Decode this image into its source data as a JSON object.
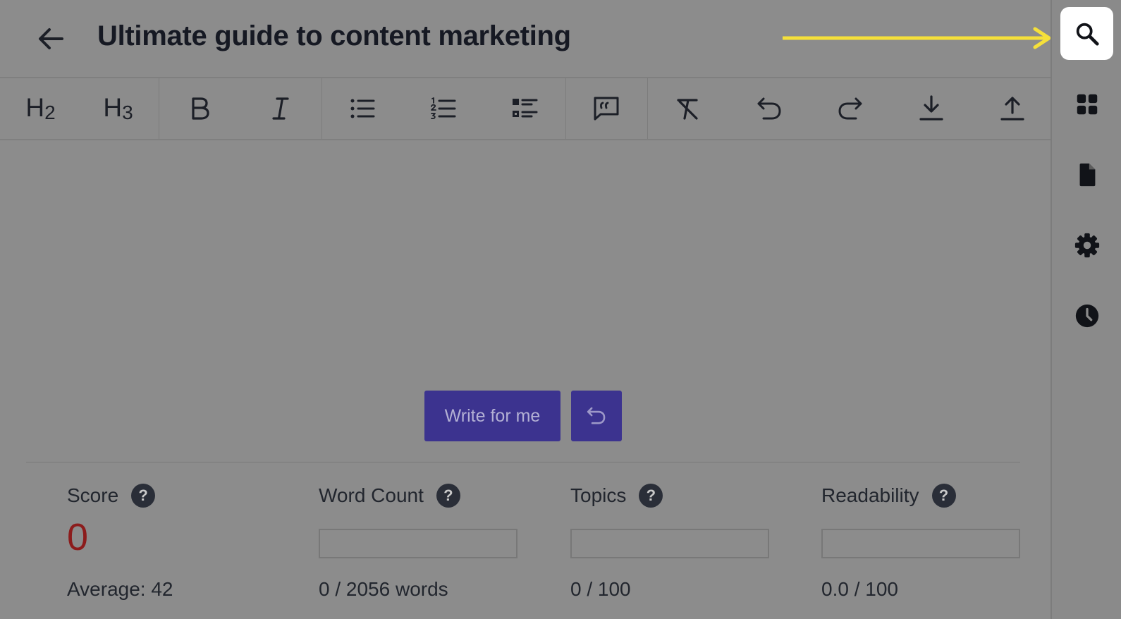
{
  "header": {
    "title": "Ultimate guide to content marketing"
  },
  "toolbar": {
    "items": [
      {
        "icon": "heading-2-icon",
        "text": "H",
        "sub": "2"
      },
      {
        "icon": "heading-3-icon",
        "text": "H",
        "sub": "3"
      },
      {
        "icon": "bold-icon"
      },
      {
        "icon": "italic-icon"
      },
      {
        "icon": "bullet-list-icon"
      },
      {
        "icon": "numbered-list-icon"
      },
      {
        "icon": "checklist-icon"
      },
      {
        "icon": "quote-icon"
      },
      {
        "icon": "clear-format-icon"
      },
      {
        "icon": "undo-icon"
      },
      {
        "icon": "redo-icon"
      },
      {
        "icon": "download-icon"
      },
      {
        "icon": "upload-icon"
      }
    ]
  },
  "editor": {
    "write_button": "Write for me",
    "undo_icon": "undo-icon"
  },
  "metrics": {
    "score": {
      "label": "Score",
      "value": "0",
      "sub": "Average: 42"
    },
    "word_count": {
      "label": "Word Count",
      "sub": "0 / 2056 words",
      "progress": 0
    },
    "topics": {
      "label": "Topics",
      "sub": "0 / 100",
      "progress": 0
    },
    "readability": {
      "label": "Readability",
      "sub": "0.0 / 100",
      "progress": 0
    },
    "help_glyph": "?"
  },
  "sidebar": {
    "items": [
      {
        "icon": "search-icon",
        "active": true
      },
      {
        "icon": "grid-icon"
      },
      {
        "icon": "document-icon"
      },
      {
        "icon": "gear-icon"
      },
      {
        "icon": "clock-icon"
      }
    ]
  },
  "colors": {
    "overlay": "#8c8c8c",
    "accent_button": "#3c338f",
    "score_red": "#8c1c1c",
    "annotation_arrow": "#f5e03a"
  }
}
